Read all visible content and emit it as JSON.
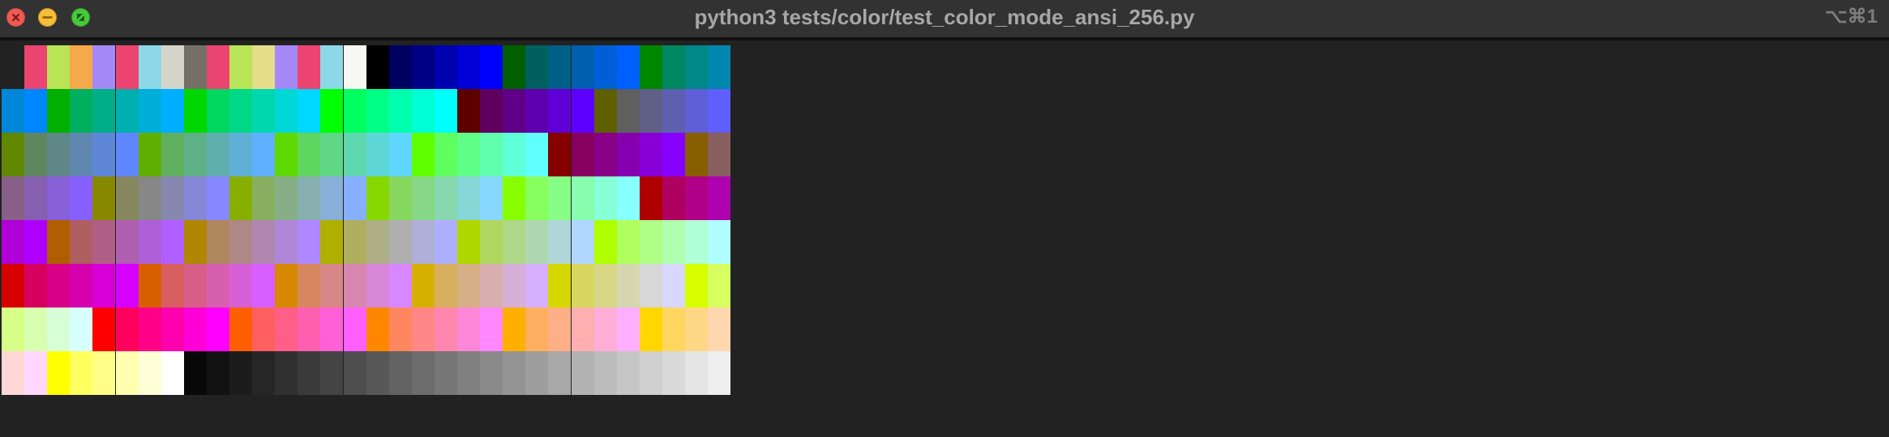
{
  "window": {
    "title": "python3 tests/color/test_color_mode_ansi_256.py",
    "shortcut": "⌥⌘1",
    "buttons": {
      "close_icon": "close-icon",
      "minimize_icon": "minimize-icon",
      "zoom_icon": "zoom-icon"
    },
    "colors": {
      "titlebar_bg": "#323232",
      "terminal_bg": "#222222",
      "close": "#ee5b55",
      "minimize": "#f4bd3a",
      "zoom": "#49c83b"
    }
  },
  "palette": {
    "mode": "ansi-256",
    "columns": 32,
    "rows": 8,
    "system_colors": [
      "#222222",
      "#eb4470",
      "#b8e455",
      "#f4a94a",
      "#a58af7",
      "#eb4470",
      "#8cd8e8",
      "#d4d4c9",
      "#757066",
      "#eb4470",
      "#b8e455",
      "#e6dd8a",
      "#a58af7",
      "#eb4470",
      "#8cd8e8",
      "#f8f8f2"
    ],
    "grayscale_start": "#080808",
    "grayscale_step": 10
  }
}
